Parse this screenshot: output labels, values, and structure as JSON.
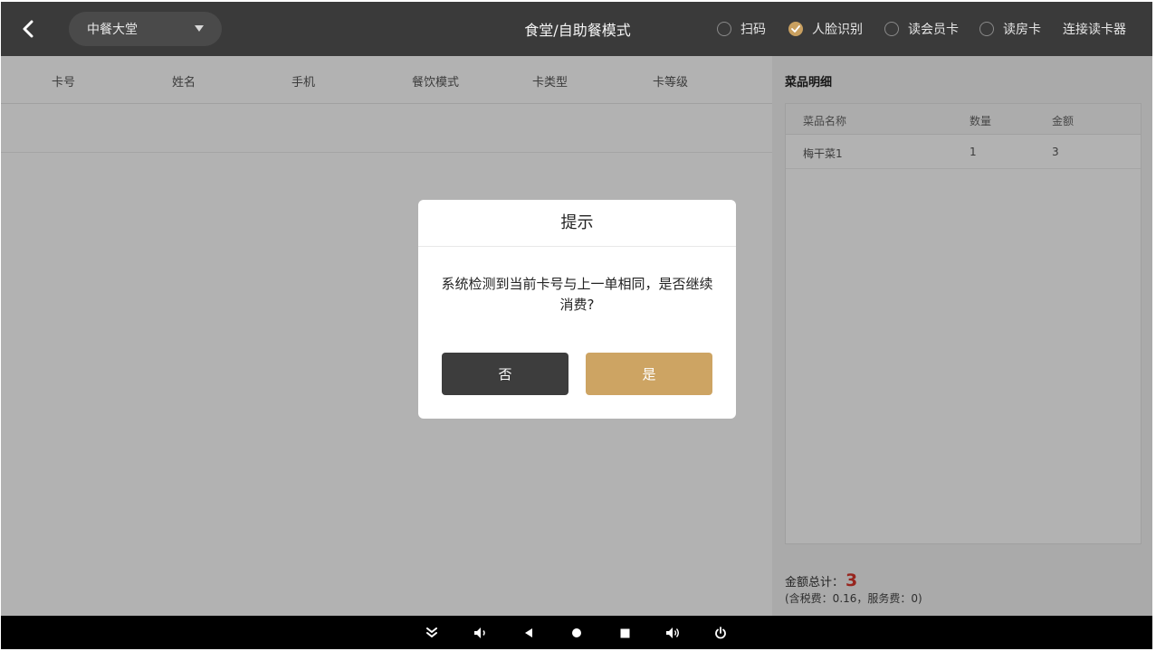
{
  "header": {
    "hall": "中餐大堂",
    "title": "食堂/自助餐模式",
    "modes": [
      {
        "label": "扫码",
        "checked": false
      },
      {
        "label": "人脸识别",
        "checked": true
      },
      {
        "label": "读会员卡",
        "checked": false
      },
      {
        "label": "读房卡",
        "checked": false
      }
    ],
    "connect_label": "连接读卡器",
    "accent_color": "#c9a060"
  },
  "member_table": {
    "columns": [
      "卡号",
      "姓名",
      "手机",
      "餐饮模式",
      "卡类型",
      "卡等级"
    ]
  },
  "detail": {
    "title": "菜品明细",
    "columns": [
      "菜品名称",
      "数量",
      "金额"
    ],
    "rows": [
      {
        "name": "梅干菜1",
        "qty": "1",
        "amount": "3"
      }
    ],
    "total_label": "金额总计：",
    "total_value": "3",
    "fee_line": "(含税费：0.16，服务费：0)"
  },
  "dialog": {
    "title": "提示",
    "message": "系统检测到当前卡号与上一单相同，是否继续消费?",
    "no_label": "否",
    "yes_label": "是"
  },
  "navbar": {
    "icons": [
      "collapse-icon",
      "volume-down-icon",
      "back-icon",
      "home-icon",
      "recents-icon",
      "volume-up-icon",
      "power-icon"
    ]
  }
}
